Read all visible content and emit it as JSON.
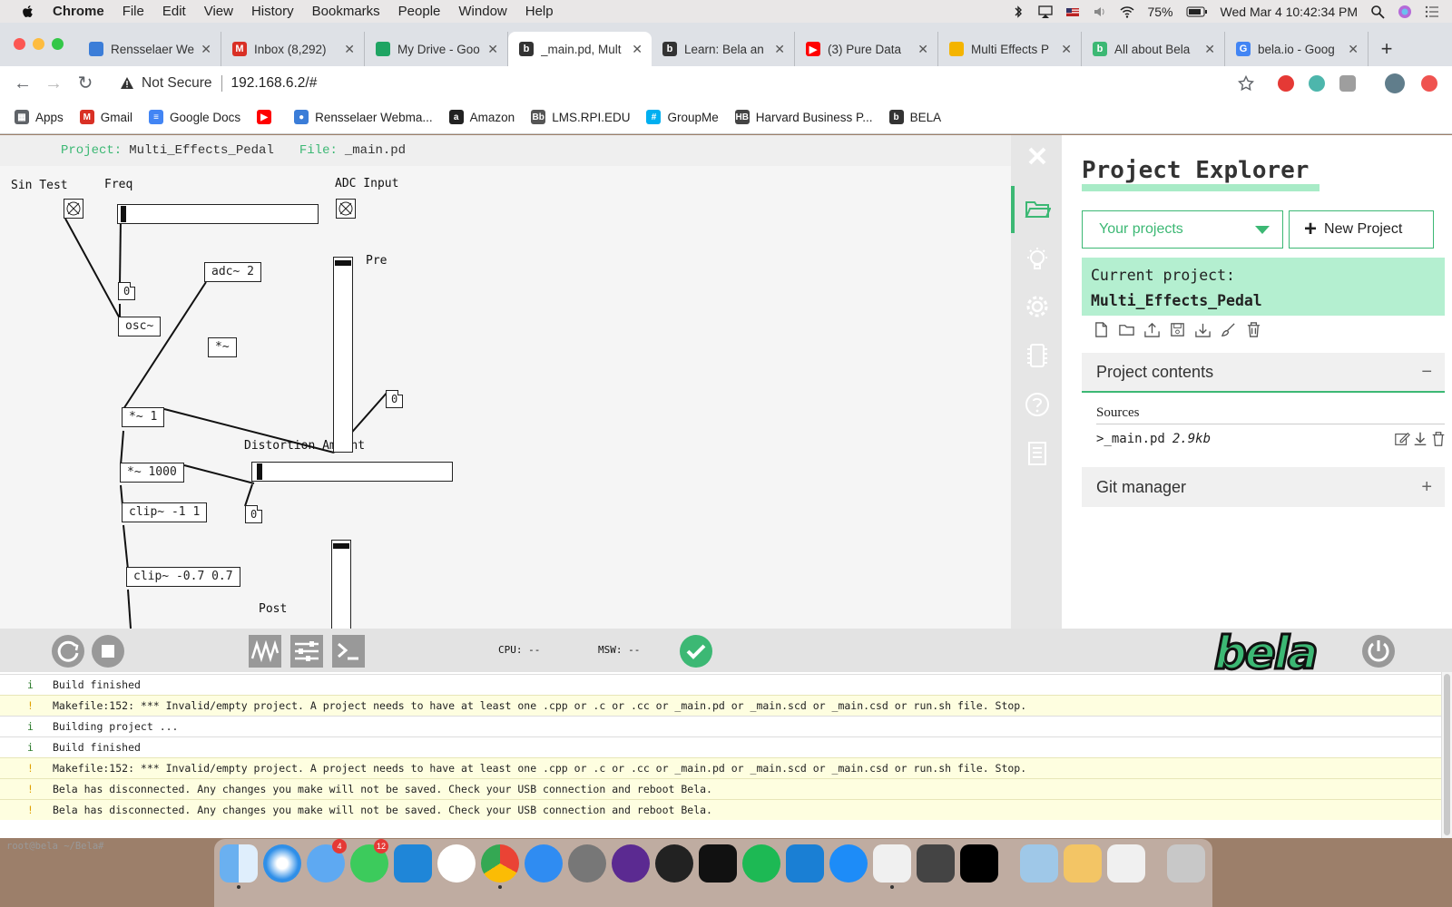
{
  "menubar": {
    "items": [
      "Chrome",
      "File",
      "Edit",
      "View",
      "History",
      "Bookmarks",
      "People",
      "Window",
      "Help"
    ],
    "battery": "75%",
    "clock": "Wed Mar 4  10:42:34 PM"
  },
  "tabs": [
    {
      "title": "Rensselaer We",
      "color": "#3b7dd8",
      "glyph": ""
    },
    {
      "title": "Inbox (8,292)",
      "color": "#d93025",
      "glyph": "M"
    },
    {
      "title": "My Drive - Goo",
      "color": "#1fa463",
      "glyph": ""
    },
    {
      "title": "_main.pd, Mult",
      "color": "#333333",
      "glyph": "b"
    },
    {
      "title": "Learn: Bela an",
      "color": "#333333",
      "glyph": "b"
    },
    {
      "title": "(3) Pure Data",
      "color": "#ff0000",
      "glyph": "▶"
    },
    {
      "title": "Multi Effects P",
      "color": "#f4b400",
      "glyph": ""
    },
    {
      "title": "All about Bela",
      "color": "#3cb874",
      "glyph": "b"
    },
    {
      "title": "bela.io - Goog",
      "color": "#4285f4",
      "glyph": "G"
    }
  ],
  "active_tab_index": 3,
  "address": {
    "security": "Not Secure",
    "url": "192.168.6.2/#"
  },
  "bookmarks": [
    {
      "label": "Apps",
      "color": "#5f6368",
      "glyph": "▦"
    },
    {
      "label": "Gmail",
      "color": "#d93025",
      "glyph": "M"
    },
    {
      "label": "Google Docs",
      "color": "#4285f4",
      "glyph": "≡"
    },
    {
      "label": "",
      "color": "#ff0000",
      "glyph": "▶"
    },
    {
      "label": "Rensselaer Webma...",
      "color": "#3b7dd8",
      "glyph": "●"
    },
    {
      "label": "Amazon",
      "color": "#222222",
      "glyph": "a"
    },
    {
      "label": "LMS.RPI.EDU",
      "color": "#555555",
      "glyph": "Bb"
    },
    {
      "label": "GroupMe",
      "color": "#00aff0",
      "glyph": "#"
    },
    {
      "label": "Harvard Business P...",
      "color": "#444444",
      "glyph": "HB"
    },
    {
      "label": "BELA",
      "color": "#333333",
      "glyph": "b"
    }
  ],
  "editor": {
    "project_label": "Project:",
    "project_name": "Multi_Effects_Pedal",
    "file_label": "File:",
    "file_name": "_main.pd"
  },
  "patch": {
    "labels": {
      "sin_test": "Sin Test",
      "freq": "Freq",
      "adc_input": "ADC Input",
      "pre": "Pre",
      "distortion_amount": "Distortion Amount",
      "post": "Post"
    },
    "objects": {
      "adc": "adc~ 2",
      "osc": "osc~",
      "mul_unconnected": "*~",
      "mul1": "*~ 1",
      "mul1000": "*~ 1000",
      "clip1": "clip~ -1 1",
      "clip07": "clip~ -0.7 0.7"
    },
    "numbers": {
      "freq_num": "0",
      "pre_num": "0",
      "dist_num": "0"
    }
  },
  "explorer": {
    "title": "Project Explorer",
    "select_value": "Your projects",
    "new_project": "New Project",
    "current_label": "Current project:",
    "current_value": "Multi_Effects_Pedal",
    "contents_label": "Project contents",
    "contents_toggle": "−",
    "sources_label": "Sources",
    "file_name": ">_main.pd",
    "file_size": "2.9kb",
    "git_label": "Git manager",
    "git_toggle": "+"
  },
  "controlbar": {
    "cpu": "CPU: --",
    "msw": "MSW: --"
  },
  "console": {
    "rows": [
      {
        "kind": "info",
        "icon": "i",
        "text": "Build finished"
      },
      {
        "kind": "warn",
        "icon": "!",
        "text": "Makefile:152: *** Invalid/empty project. A project needs to have at least one .cpp or .c or .cc or _main.pd or _main.scd or _main.csd or run.sh file.  Stop."
      },
      {
        "kind": "info",
        "icon": "i",
        "text": "Building project ..."
      },
      {
        "kind": "info",
        "icon": "i",
        "text": "Build finished"
      },
      {
        "kind": "warn",
        "icon": "!",
        "text": "Makefile:152: *** Invalid/empty project. A project needs to have at least one .cpp or .c or .cc or _main.pd or _main.scd or _main.csd or run.sh file.  Stop."
      },
      {
        "kind": "warn",
        "icon": "!",
        "text": "Bela has disconnected. Any changes you make will not be saved. Check your USB connection and reboot Bela."
      },
      {
        "kind": "warn",
        "icon": "!",
        "text": "Bela has disconnected. Any changes you make will not be saved. Check your USB connection and reboot Bela."
      }
    ],
    "prompt": "root@bela ~/Bela#"
  },
  "dock": {
    "badges": {
      "messages": "4",
      "facetime": "12"
    }
  },
  "colors": {
    "accent": "#3cb874",
    "accent_light": "#b4efd0",
    "warning_row": "#fefee0"
  }
}
